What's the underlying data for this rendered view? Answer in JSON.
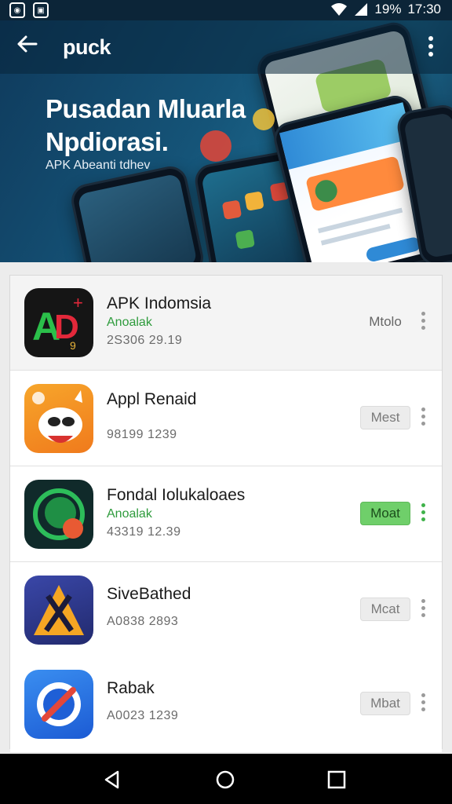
{
  "status_bar": {
    "battery": "19%",
    "time": "17:30"
  },
  "app_bar": {
    "title": "puck"
  },
  "banner": {
    "headline_line1": "Pusadan Mluarla",
    "headline_line2": "Npdiorasi.",
    "subtitle": "APK Abeanti tdhev"
  },
  "apps": [
    {
      "name": "APK Indomsia",
      "category": "Anoalak",
      "meta": "2S306 29.19",
      "button": "Mtolo",
      "button_style": "plain"
    },
    {
      "name": "Appl Renaid",
      "category": "",
      "meta": "98199 1239",
      "button": "Mest",
      "button_style": "gray"
    },
    {
      "name": "Fondal Iolukaloaes",
      "category": "Anoalak",
      "meta": "43319 12.39",
      "button": "Moat",
      "button_style": "green"
    },
    {
      "name": "SiveBathed",
      "category": "",
      "meta": "A0838 2893",
      "button": "Mcat",
      "button_style": "gray"
    },
    {
      "name": "Rabak",
      "category": "",
      "meta": "A0023 1239",
      "button": "Mbat",
      "button_style": "gray"
    }
  ],
  "icons": {
    "back": "arrow-left-icon",
    "more": "more-vertical-icon",
    "nav_back": "triangle-back-icon",
    "nav_home": "circle-home-icon",
    "nav_recents": "square-recents-icon"
  },
  "colors": {
    "accent_green": "#2e9b3c",
    "banner_dark": "#0f3a5c"
  }
}
